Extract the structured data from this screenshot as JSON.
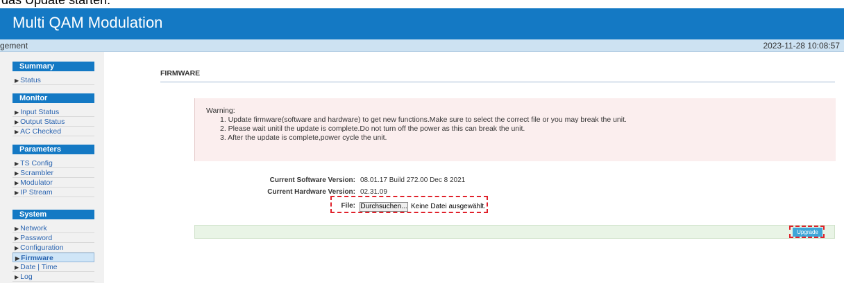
{
  "top_caption": "das Update starten.",
  "header": {
    "title": "Multi QAM Modulation"
  },
  "subbar": {
    "left_text": "gement",
    "datetime": "2023-11-28 10:08:57"
  },
  "sidebar": {
    "groups": [
      {
        "label": "Summary",
        "items": [
          {
            "label": "Status"
          }
        ]
      },
      {
        "label": "Monitor",
        "items": [
          {
            "label": "Input Status"
          },
          {
            "label": "Output Status"
          },
          {
            "label": "AC Checked"
          }
        ]
      },
      {
        "label": "Parameters",
        "items": [
          {
            "label": "TS Config"
          },
          {
            "label": "Scrambler"
          },
          {
            "label": "Modulator"
          },
          {
            "label": "IP Stream"
          }
        ]
      },
      {
        "label": "System",
        "items": [
          {
            "label": "Network"
          },
          {
            "label": "Password"
          },
          {
            "label": "Configuration"
          },
          {
            "label": "Firmware"
          },
          {
            "label": "Date | Time"
          },
          {
            "label": "Log"
          }
        ]
      }
    ],
    "active_item": "Firmware"
  },
  "page": {
    "section_title": "FIRMWARE"
  },
  "warning": {
    "title": "Warning:",
    "lines": [
      "1. Update firmware(software and hardware) to get new functions.Make sure to select the correct file or you may break the unit.",
      "2. Please wait unitil the update is complete.Do not turn off the power as this can break the unit.",
      "3. After the update is complete,power cycle the unit."
    ]
  },
  "info": {
    "software_label": "Current Software Version:",
    "software_value": "08.01.17 Build 272.00 Dec 8 2021",
    "hardware_label": "Current Hardware Version:",
    "hardware_value": "02.31.09",
    "file_label": "File:",
    "file_button": "Durchsuchen...",
    "file_status": "Keine Datei ausgewählt."
  },
  "actions": {
    "upgrade_label": "Upgrade"
  },
  "colors": {
    "header_blue": "#1479c4",
    "highlight_red": "#e0202a",
    "upgrade_button": "#3ea6d8"
  }
}
